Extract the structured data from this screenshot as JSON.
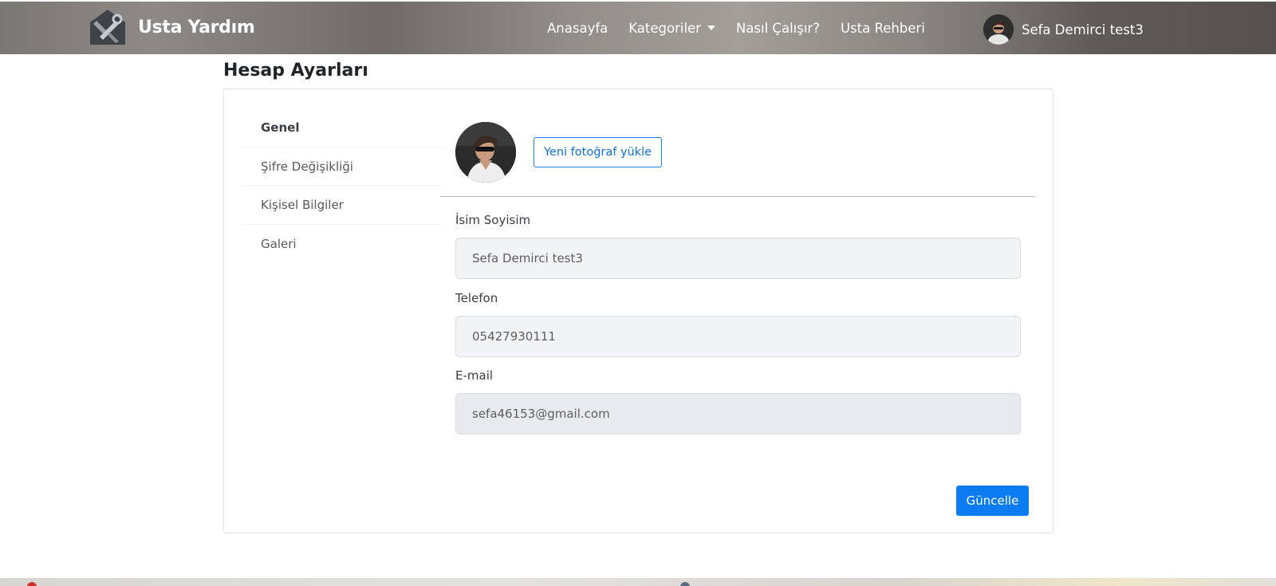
{
  "navbar": {
    "brand": "Usta Yardım",
    "links": {
      "home": "Anasayfa",
      "categories": "Kategoriler",
      "how_it_works": "Nasıl Çalışır?",
      "guide": "Usta Rehberi"
    },
    "user_name": "Sefa Demirci test3"
  },
  "page": {
    "title": "Hesap Ayarları"
  },
  "sidebar": {
    "items": [
      {
        "label": "Genel"
      },
      {
        "label": "Şifre Değişikliği"
      },
      {
        "label": "Kişisel Bilgiler"
      },
      {
        "label": "Galeri"
      }
    ]
  },
  "profile": {
    "upload_label": "Yeni fotoğraf yükle"
  },
  "form": {
    "name": {
      "label": "İsim Soyisim",
      "value": "Sefa Demirci test3"
    },
    "phone": {
      "label": "Telefon",
      "value": "05427930111"
    },
    "email": {
      "label": "E-mail",
      "value": "sefa46153@gmail.com"
    },
    "submit_label": "Güncelle"
  },
  "colors": {
    "primary": "#0d7bf2",
    "outline": "#1d7be6"
  },
  "icons": {
    "brand": "tools-logo-icon",
    "dropdown": "caret-down-icon"
  }
}
